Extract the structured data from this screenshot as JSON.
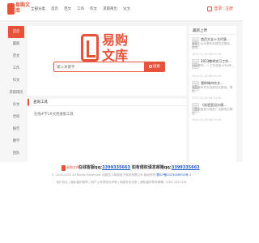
{
  "header": {
    "logo_text": "易购文库",
    "nav": [
      "全部分类",
      "首页",
      "范文",
      "工作",
      "作文",
      "求职简历",
      "论文"
    ],
    "upload_label": "登录",
    "divider": "|",
    "register_label": "注册"
  },
  "sidebar": {
    "items": [
      "首页",
      "最新",
      "范文",
      "工作",
      "作文",
      "求职简历",
      "论文",
      "合同",
      "报告",
      "教学",
      "团队"
    ]
  },
  "hero": {
    "logo_text": "易购\n文库",
    "search_placeholder": "输入关键字",
    "search_button": "搜索"
  },
  "content": {
    "title": "查询工具",
    "text": "在线#学1#文档搜索工具"
  },
  "right": {
    "title": "最新上传",
    "items": [
      {
        "head": "首页大全十大代表…",
        "desc": "首页十大代表作全部范文精选，带你…",
        "date": "2025-01-16 06:20:09"
      },
      {
        "head": "2023教师实习工作…",
        "desc": "XXX学校…一工作总结1XXX年…",
        "date": "2025-01-16 06:20:09"
      },
      {
        "head": "我的城市作文…",
        "desc": "我的城市作文全部范文精选，带你…",
        "date": "2025-01-16 06:20:09"
      },
      {
        "head": "《实验室设计规…",
        "desc": "《实验室设计规范》全部范文精选…",
        "date": "2025-01-16 06:20:09"
      }
    ]
  },
  "footer": {
    "logo_text": "易购文库",
    "contact_prefix": "在线客服qq:",
    "contact_qq": "3399335663",
    "contact_mid": "   如有侵权请发邮箱qq:",
    "contact_qq2": "3399335663",
    "copyright": "© 2016-2023 All Rights Reserved. 成都艺人网络电子商务有限公司 版权所有 ",
    "icp": "蜀ICP备2023006933号-1",
    "links": "用户协议 | 隐私保护政策 | 用户上传须知与声明 | 网络安全法条 | 侵权保护联系邮箱: 1002-3321234"
  }
}
